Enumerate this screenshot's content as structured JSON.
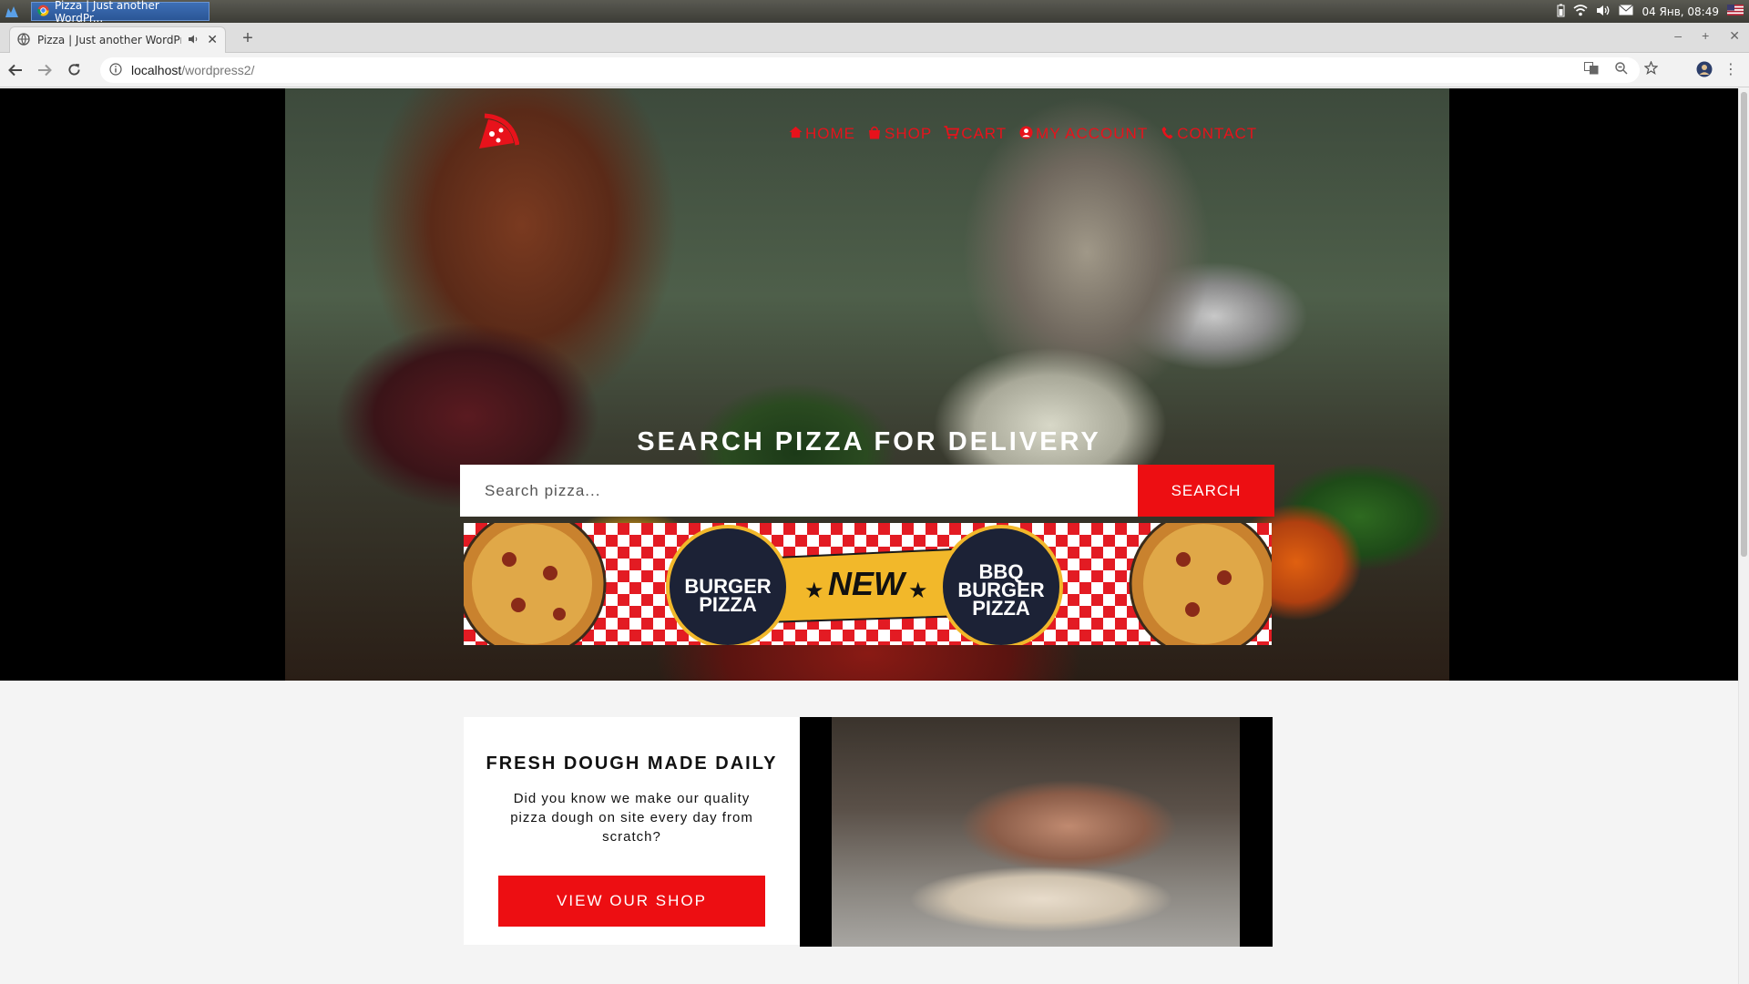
{
  "os": {
    "task_title": "Pizza | Just another WordPr...",
    "clock": "04 Янв, 08:49"
  },
  "browser": {
    "tab_title": "Pizza | Just another WordPr",
    "url_host": "localhost",
    "url_path": "/wordpress2/"
  },
  "site": {
    "nav": [
      {
        "label": "HOME",
        "icon": "home-icon"
      },
      {
        "label": "SHOP",
        "icon": "bag-icon"
      },
      {
        "label": "CART",
        "icon": "cart-icon"
      },
      {
        "label": "MY ACCOUNT",
        "icon": "user-icon"
      },
      {
        "label": "CONTACT",
        "icon": "phone-icon"
      }
    ],
    "hero_title": "SEARCH PIZZA FOR DELIVERY",
    "search": {
      "placeholder": "Search pizza...",
      "button": "SEARCH"
    },
    "promo": {
      "left_badge": [
        "BURGER",
        "PIZZA"
      ],
      "center": "NEW",
      "right_badge": [
        "BBQ",
        "BURGER",
        "PIZZA"
      ]
    },
    "feature": {
      "title": "FRESH DOUGH MADE DAILY",
      "text": "Did you know we make our quality pizza dough on site every day from scratch?",
      "button": "VIEW OUR SHOP"
    }
  },
  "colors": {
    "accent": "#ed0e12",
    "nav": "#e8121b"
  }
}
